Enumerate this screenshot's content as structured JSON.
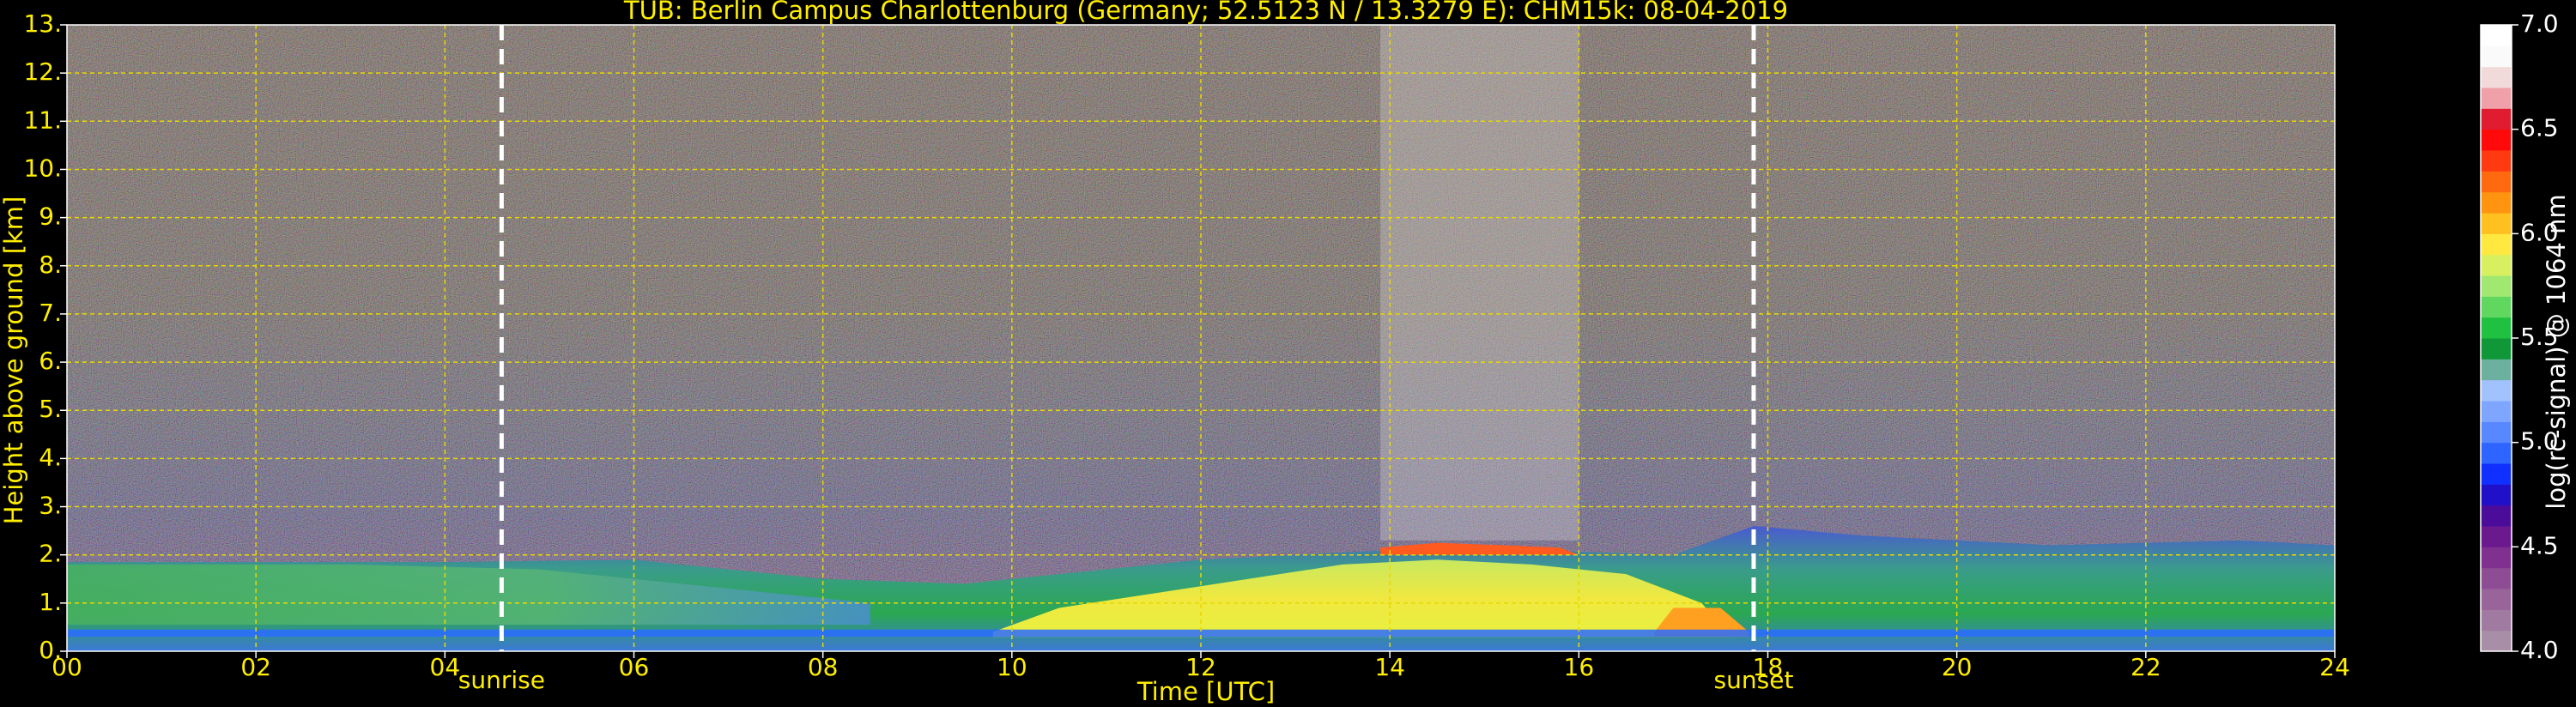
{
  "chart_data": {
    "type": "heatmap",
    "title": "TUB: Berlin Campus Charlottenburg (Germany; 52.5123 N / 13.3279 E):    CHM15k: 08-04-2019",
    "xlabel": "Time [UTC]",
    "ylabel": "Height above ground [km]",
    "xlim": [
      0,
      24
    ],
    "ylim": [
      0,
      13
    ],
    "x_ticks": [
      "00",
      "02",
      "04",
      "06",
      "08",
      "10",
      "12",
      "14",
      "16",
      "18",
      "20",
      "22",
      "24"
    ],
    "x_tick_values": [
      0,
      2,
      4,
      6,
      8,
      10,
      12,
      14,
      16,
      18,
      20,
      22,
      24
    ],
    "y_ticks": [
      "0.",
      "1.",
      "2.",
      "3.",
      "4.",
      "5.",
      "6.",
      "7.",
      "8.",
      "9.",
      "10.",
      "11.",
      "12.",
      "13."
    ],
    "y_tick_values": [
      0,
      1,
      2,
      3,
      4,
      5,
      6,
      7,
      8,
      9,
      10,
      11,
      12,
      13
    ],
    "grid": true,
    "events": [
      {
        "label": "sunrise",
        "time": 4.6
      },
      {
        "label": "sunset",
        "time": 17.85
      }
    ],
    "colorbar": {
      "label": "log(rc-signal) @ 1064 nm",
      "range": [
        4.0,
        7.0
      ],
      "ticks": [
        "4.0",
        "4.5",
        "5.0",
        "5.5",
        "6.0",
        "6.5",
        "7.0"
      ],
      "tick_values": [
        4.0,
        4.5,
        5.0,
        5.5,
        6.0,
        6.5,
        7.0
      ],
      "colors": [
        "#a88ea6",
        "#a07aa0",
        "#98649a",
        "#8e4c94",
        "#80308e",
        "#6a1a8e",
        "#4c0c9a",
        "#2010c8",
        "#1030ff",
        "#2e64ff",
        "#5888ff",
        "#7ea6ff",
        "#a2c2ff",
        "#6cb0a0",
        "#109838",
        "#20c040",
        "#60d860",
        "#a0e870",
        "#d8f060",
        "#ffe840",
        "#ffc020",
        "#ff9410",
        "#ff6a10",
        "#ff3a10",
        "#ff0a0a",
        "#e01c30",
        "#f0a0a8",
        "#f2dada",
        "#fafafa",
        "#ffffff"
      ]
    },
    "colors": {
      "text": "#ffee00",
      "grid": "#e8d800",
      "event_line": "#ffffff",
      "background": "#000000"
    }
  }
}
